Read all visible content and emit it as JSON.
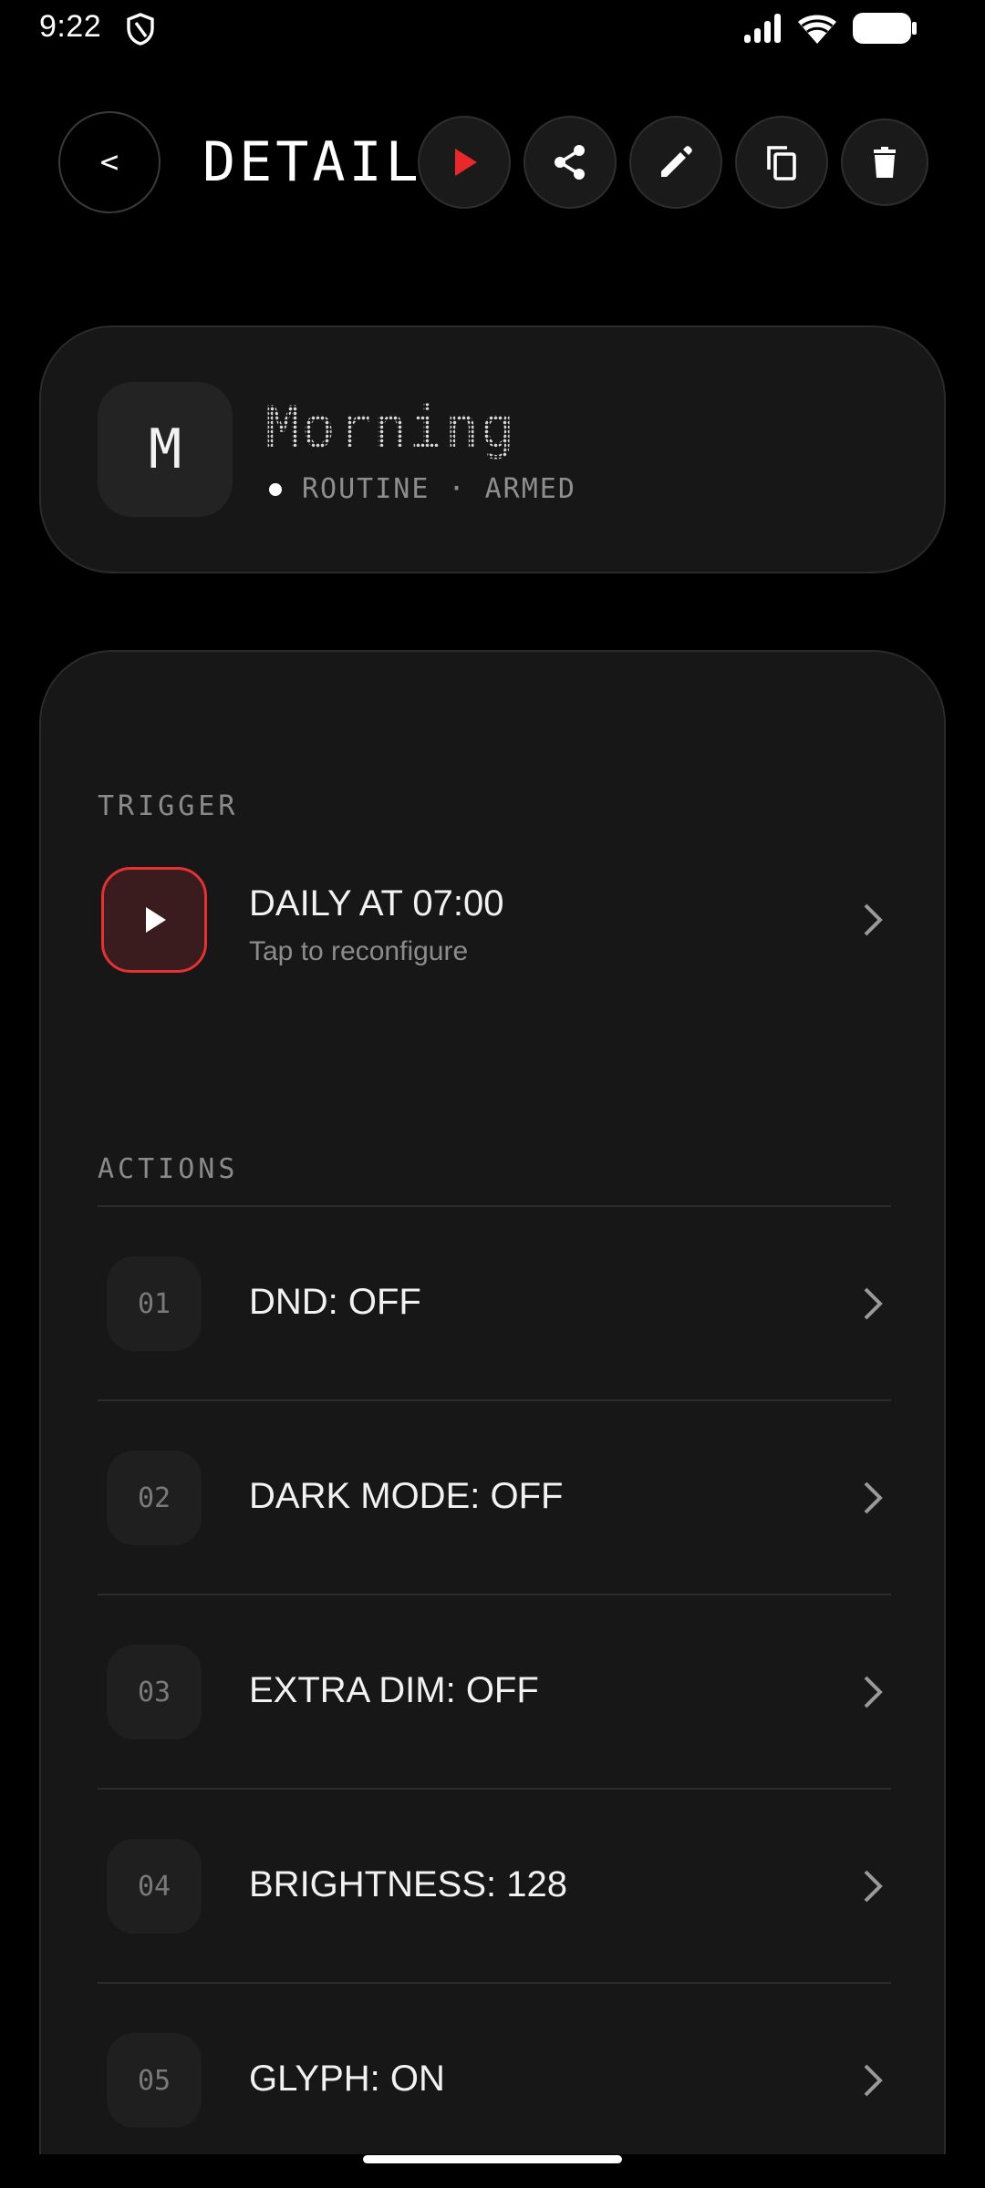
{
  "status_bar": {
    "time": "9:22"
  },
  "header": {
    "back_label": "<",
    "title": "DETAIL",
    "actions": [
      {
        "name": "run",
        "icon": "play-icon",
        "color": "#e8282b"
      },
      {
        "name": "share",
        "icon": "share-icon",
        "color": "#ffffff"
      },
      {
        "name": "edit",
        "icon": "pencil-icon",
        "color": "#ffffff"
      },
      {
        "name": "duplicate",
        "icon": "copy-icon",
        "color": "#ffffff"
      },
      {
        "name": "delete",
        "icon": "trash-icon",
        "color": "#ffffff"
      }
    ]
  },
  "routine": {
    "avatar_letter": "M",
    "name": "Morning",
    "meta": "ROUTINE · ARMED"
  },
  "trigger": {
    "section_label": "TRIGGER",
    "title": "DAILY AT 07:00",
    "subtitle": "Tap to reconfigure",
    "accent": "#e23232"
  },
  "actions": {
    "section_label": "ACTIONS",
    "items": [
      {
        "number": "01",
        "label": "DND: OFF"
      },
      {
        "number": "02",
        "label": "DARK MODE: OFF"
      },
      {
        "number": "03",
        "label": "EXTRA DIM: OFF"
      },
      {
        "number": "04",
        "label": "BRIGHTNESS: 128"
      },
      {
        "number": "05",
        "label": "GLYPH: ON"
      }
    ]
  },
  "colors": {
    "background": "#000000",
    "card": "#171717",
    "accent_red": "#e8282b"
  }
}
